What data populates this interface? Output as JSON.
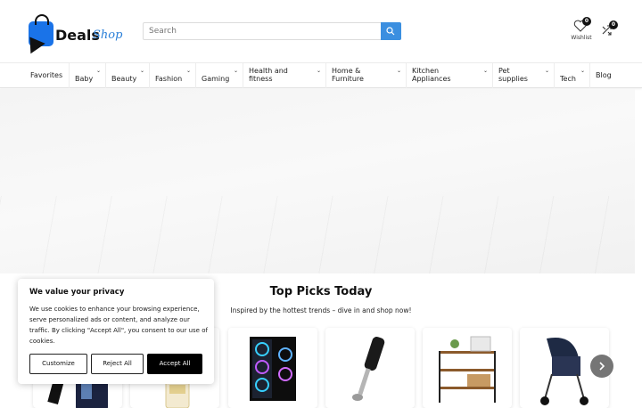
{
  "brand": {
    "word1": "Deals",
    "word2": "Shop"
  },
  "search": {
    "placeholder": "Search"
  },
  "header": {
    "wishlist_label": "Wishlist",
    "wishlist_count": "0",
    "compare_count": "0"
  },
  "nav": [
    {
      "label": "Favorites"
    },
    {
      "label": "Baby"
    },
    {
      "label": "Beauty"
    },
    {
      "label": "Fashion"
    },
    {
      "label": "Gaming"
    },
    {
      "label_line1": "Health and",
      "label_line2": "fitness"
    },
    {
      "label_line1": "Home &",
      "label_line2": "Furniture"
    },
    {
      "label_line1": "Kitchen",
      "label_line2": "Appliances"
    },
    {
      "label_line1": "Pet",
      "label_line2": "supplies"
    },
    {
      "label": "Tech"
    },
    {
      "label": "Blog"
    }
  ],
  "section": {
    "title": "Top Picks Today",
    "subtitle": "Inspired by the hottest trends – dive in and shop now!"
  },
  "products": [
    {
      "icon": "phone-product-image"
    },
    {
      "icon": "bottle-product-image"
    },
    {
      "icon": "gaming-pc-product-image"
    },
    {
      "icon": "hand-blender-product-image"
    },
    {
      "icon": "shoe-rack-product-image"
    },
    {
      "icon": "stroller-product-image"
    }
  ],
  "cookie": {
    "title": "We value your privacy",
    "body": "We use cookies to enhance your browsing experience, serve personalized ads or content, and analyze our traffic. By clicking \"Accept All\", you consent to our use of cookies.",
    "customize": "Customize",
    "reject": "Reject All",
    "accept": "Accept All"
  },
  "colors": {
    "accent": "#3b8fe0",
    "brand_blue": "#1a73e8",
    "dark": "#000000"
  }
}
